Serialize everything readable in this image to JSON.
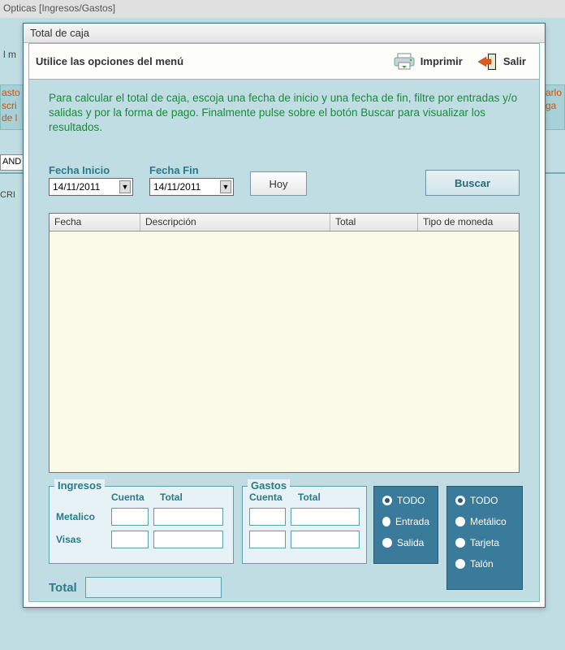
{
  "app": {
    "title_fragment": "Opticas   [Ingresos/Gastos]"
  },
  "bg": {
    "menu_fragment": "l m",
    "orange1": "asto\nscri\nde l",
    "orange2": "arlo\nga",
    "dropdown_fragment": "AND",
    "small_label": "CRI"
  },
  "dialog": {
    "title": "Total de caja"
  },
  "toolbar": {
    "hint": "Utilice las opciones del menú",
    "print_label": "Imprimir",
    "exit_label": "Salir"
  },
  "instructions": "Para calcular el total de caja, escoja una fecha de inicio y una fecha de fin, filtre por entradas y/o salidas y por la forma de pago. Finalmente pulse sobre el botón Buscar para visualizar los resultados.",
  "dates": {
    "start_label": "Fecha Inicio",
    "end_label": "Fecha Fin",
    "start_value": "14/11/2011",
    "end_value": "14/11/2011",
    "today_label": "Hoy",
    "search_label": "Buscar"
  },
  "grid": {
    "col_fecha": "Fecha",
    "col_desc": "Descripción",
    "col_total": "Total",
    "col_moneda": "Tipo de moneda"
  },
  "ingresos": {
    "legend": "Ingresos",
    "head_cuenta": "Cuenta",
    "head_total": "Total",
    "row1_label": "Metalico",
    "row2_label": "Visas"
  },
  "gastos": {
    "legend": "Gastos",
    "head_cuenta": "Cuenta",
    "head_total": "Total"
  },
  "filter1": {
    "opt_todo": "TODO",
    "opt_entrada": "Entrada",
    "opt_salida": "Salida"
  },
  "filter2": {
    "opt_todo": "TODO",
    "opt_metalico": "Metálico",
    "opt_tarjeta": "Tarjeta",
    "opt_talon": "Talón"
  },
  "total_label": "Total"
}
